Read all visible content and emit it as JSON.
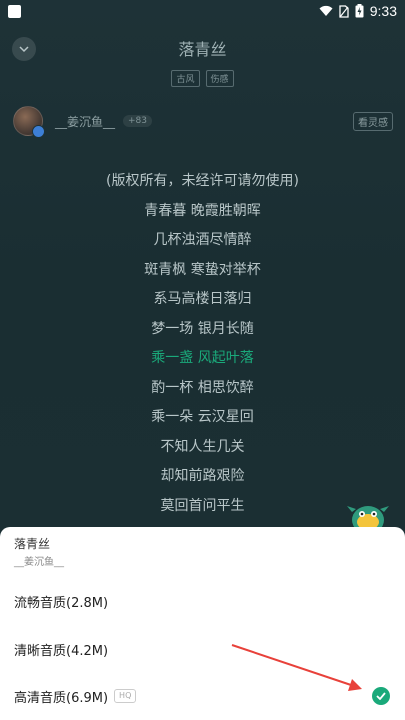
{
  "status_bar": {
    "time": "9:33"
  },
  "header": {
    "title": "落青丝",
    "tags": [
      "古风",
      "伤感"
    ]
  },
  "artist": {
    "name": "__姜沉鱼__",
    "count": "+83",
    "action_label": "看灵感"
  },
  "lyrics": [
    "(版权所有，未经许可请勿使用)",
    "青春暮 晚霞胜朝晖",
    "几杯浊酒尽情醉",
    "斑青枫 寒蛰对举杯",
    "系马高楼日落归",
    "梦一场 银月长随",
    "乘一盏 风起叶落",
    "酌一杯 相思饮醉",
    "乘一朵 云汉星回",
    "不知人生几关",
    "却知前路艰险",
    "莫回首问平生"
  ],
  "active_lyric_index": 6,
  "sheet": {
    "title": "落青丝",
    "subtitle": "__姜沉鱼__",
    "options": [
      {
        "label": "流畅音质(2.8M)",
        "selected": false
      },
      {
        "label": "清晰音质(4.2M)",
        "selected": false
      },
      {
        "label": "高清音质(6.9M)",
        "badge": "HQ",
        "selected": true
      }
    ]
  },
  "colors": {
    "accent": "#1aa97a",
    "annotation_arrow": "#e8413a"
  }
}
